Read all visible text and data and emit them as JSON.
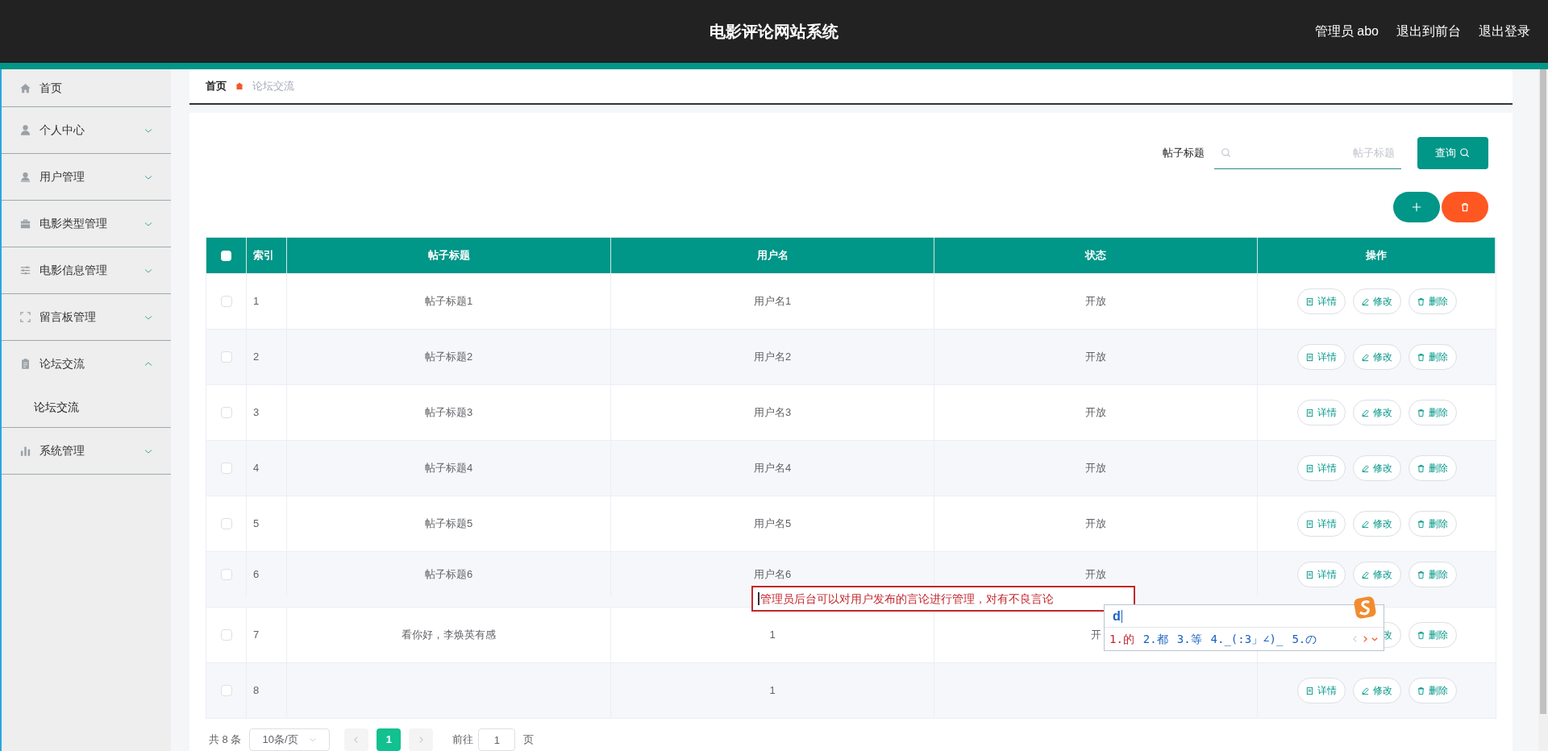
{
  "header": {
    "title": "电影评论网站系统",
    "links": [
      "管理员 abo",
      "退出到前台",
      "退出登录"
    ]
  },
  "sidebar": {
    "items": [
      {
        "label": "首页"
      },
      {
        "label": "个人中心",
        "expanded": false
      },
      {
        "label": "用户管理",
        "expanded": false
      },
      {
        "label": "电影类型管理",
        "expanded": false
      },
      {
        "label": "电影信息管理",
        "expanded": false
      },
      {
        "label": "留言板管理",
        "expanded": false
      },
      {
        "label": "论坛交流",
        "expanded": true,
        "children": [
          {
            "label": "论坛交流"
          }
        ]
      },
      {
        "label": "系统管理",
        "expanded": false
      }
    ]
  },
  "breadcrumb": [
    "首页",
    "论坛交流"
  ],
  "search": {
    "label": "帖子标题",
    "placeholder": "帖子标题",
    "button": "查询"
  },
  "table": {
    "all_checked": false,
    "columns": [
      "索引",
      "帖子标题",
      "用户名",
      "状态",
      "操作"
    ],
    "rows": [
      {
        "checked": false,
        "index": "1",
        "title": "帖子标题1",
        "username": "用户名1",
        "status": "开放",
        "actions": [
          {
            "kind": "detail",
            "label": "详情"
          },
          {
            "kind": "edit",
            "label": "修改"
          },
          {
            "kind": "delete",
            "label": "删除"
          }
        ]
      },
      {
        "checked": false,
        "index": "2",
        "title": "帖子标题2",
        "username": "用户名2",
        "status": "开放",
        "actions": [
          {
            "kind": "detail",
            "label": "详情"
          },
          {
            "kind": "edit",
            "label": "修改"
          },
          {
            "kind": "delete",
            "label": "删除"
          }
        ]
      },
      {
        "checked": false,
        "index": "3",
        "title": "帖子标题3",
        "username": "用户名3",
        "status": "开放",
        "actions": [
          {
            "kind": "detail",
            "label": "详情"
          },
          {
            "kind": "edit",
            "label": "修改"
          },
          {
            "kind": "delete",
            "label": "删除"
          }
        ]
      },
      {
        "checked": false,
        "index": "4",
        "title": "帖子标题4",
        "username": "用户名4",
        "status": "开放",
        "actions": [
          {
            "kind": "detail",
            "label": "详情"
          },
          {
            "kind": "edit",
            "label": "修改"
          },
          {
            "kind": "delete",
            "label": "删除"
          }
        ]
      },
      {
        "checked": false,
        "index": "5",
        "title": "帖子标题5",
        "username": "用户名5",
        "status": "开放",
        "actions": [
          {
            "kind": "detail",
            "label": "详情"
          },
          {
            "kind": "edit",
            "label": "修改"
          },
          {
            "kind": "delete",
            "label": "删除"
          }
        ]
      },
      {
        "checked": false,
        "index": "6",
        "title": "帖子标题6",
        "username": "用户名6",
        "status": "开放",
        "actions": [
          {
            "kind": "detail",
            "label": "详情"
          },
          {
            "kind": "edit",
            "label": "修改"
          },
          {
            "kind": "delete",
            "label": "删除"
          }
        ]
      },
      {
        "checked": false,
        "index": "7",
        "title": "看你好，李焕英有感",
        "username": "1",
        "status": "开",
        "actions": [
          {
            "kind": "edit",
            "label": "改"
          },
          {
            "kind": "delete",
            "label": "删除"
          }
        ]
      },
      {
        "checked": false,
        "index": "8",
        "username": "1",
        "actions": [
          {
            "kind": "detail",
            "label": "详情"
          },
          {
            "kind": "edit",
            "label": "修改"
          },
          {
            "kind": "delete",
            "label": "删除"
          }
        ]
      }
    ]
  },
  "pagination": {
    "total": "共 8 条",
    "page_size": "10条/页",
    "pages": [
      {
        "label": "1",
        "selected": true
      }
    ],
    "goto_label": "前往",
    "goto_value": "1",
    "goto_suffix": "页"
  },
  "text_input": {
    "value": "管理员后台可以对用户发布的言论进行管理，对有不良言论"
  },
  "ime": {
    "composition": "d",
    "candidates": [
      {
        "label": "1.的",
        "selected": true
      },
      {
        "label": "2.都",
        "selected": false
      },
      {
        "label": "3.等",
        "selected": false
      },
      {
        "label": "4._(:3」∠)_",
        "selected": false
      },
      {
        "label": "5.の",
        "selected": false
      }
    ]
  }
}
